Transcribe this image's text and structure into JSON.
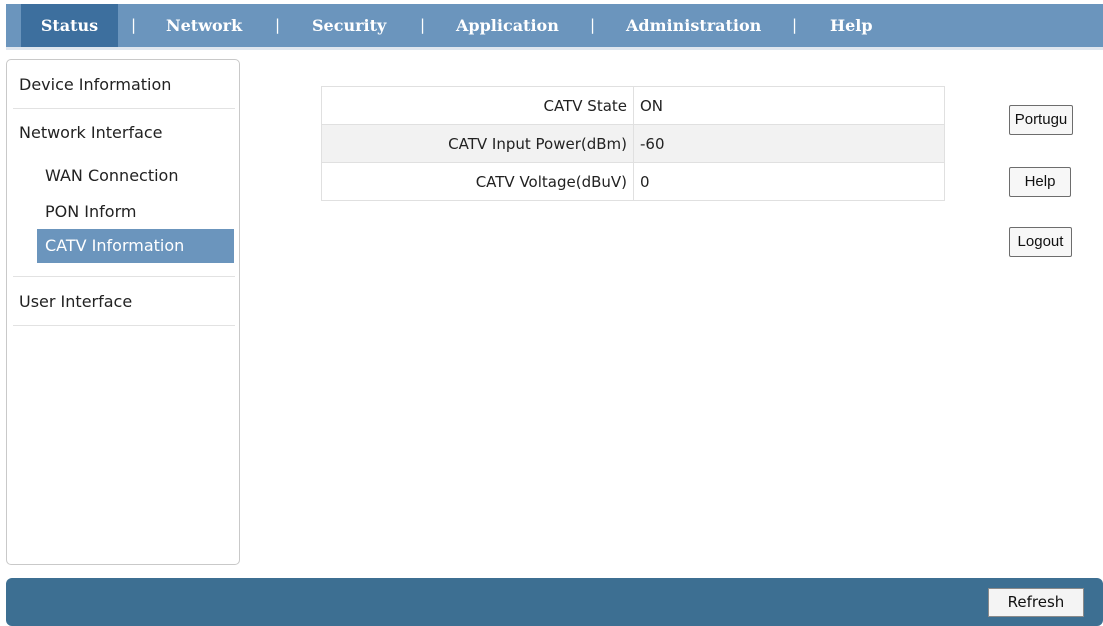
{
  "nav": {
    "items": [
      "Status",
      "Network",
      "Security",
      "Application",
      "Administration",
      "Help"
    ],
    "separator": "|",
    "active": "Status"
  },
  "sidebar": {
    "device_information": "Device Information",
    "network_interface": "Network Interface",
    "sub_items": [
      "WAN Connection",
      "PON Inform",
      "CATV Information"
    ],
    "active_sub": "CATV Information",
    "user_interface": "User Interface"
  },
  "table": {
    "rows": [
      {
        "label": "CATV State",
        "value": "ON"
      },
      {
        "label": "CATV Input Power(dBm)",
        "value": "-60"
      },
      {
        "label": "CATV Voltage(dBuV)",
        "value": "0"
      }
    ]
  },
  "buttons": {
    "language": "Portugu",
    "help": "Help",
    "logout": "Logout"
  },
  "footer": {
    "refresh": "Refresh"
  },
  "colors": {
    "nav_bg": "#6b95bd",
    "nav_active": "#3d6f9e",
    "footer_bg": "#3d6f92"
  }
}
